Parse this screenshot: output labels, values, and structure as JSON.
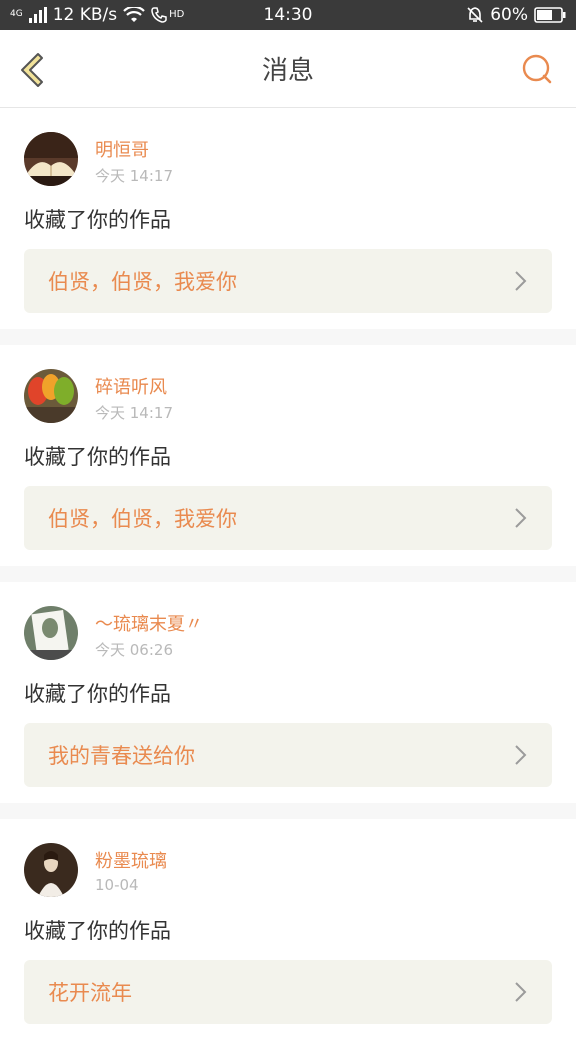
{
  "status_bar": {
    "network": "4G",
    "speed": "12 KB/s",
    "hd": "HD",
    "time": "14:30",
    "battery": "60%"
  },
  "header": {
    "title": "消息"
  },
  "messages": [
    {
      "user": "明恒哥",
      "time": "今天 14:17",
      "action": "收藏了你的作品",
      "work": "伯贤，伯贤，我爱你"
    },
    {
      "user": "碎语听风",
      "time": "今天 14:17",
      "action": "收藏了你的作品",
      "work": "伯贤，伯贤，我爱你"
    },
    {
      "user": "～琉璃末夏〃",
      "time": "今天 06:26",
      "action": "收藏了你的作品",
      "work": "我的青春送给你"
    },
    {
      "user": "粉墨琉璃",
      "time": "10-04",
      "action": "收藏了你的作品",
      "work": "花开流年"
    }
  ],
  "icons": {
    "back": "chevron-left-icon",
    "search": "search-icon",
    "row_arrow": "chevron-right-icon"
  },
  "colors": {
    "accent": "#e98a4f",
    "back_fill": "#f2e39a"
  }
}
